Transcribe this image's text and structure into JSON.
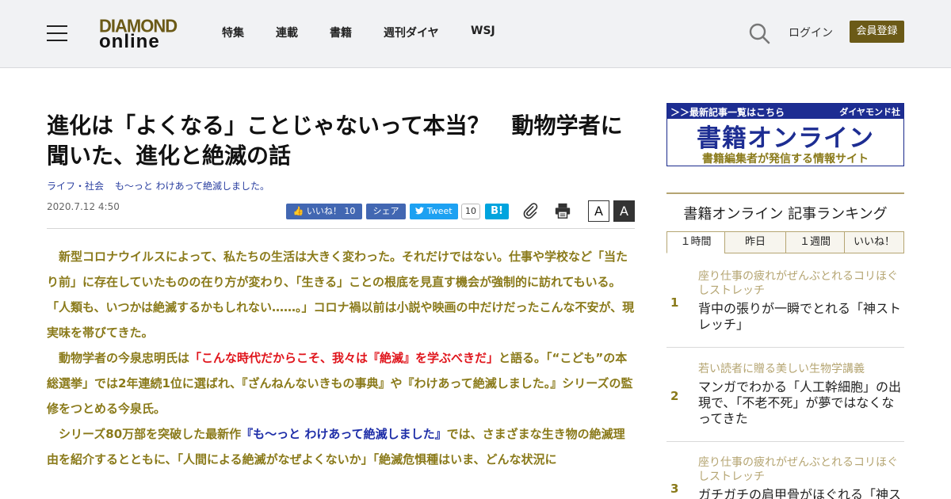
{
  "header": {
    "logo_line1": "DIAMOND",
    "logo_line2": "online",
    "nav": [
      "特集",
      "連載",
      "書籍",
      "週刊ダイヤ",
      "WSJ"
    ],
    "login": "ログイン",
    "register": "会員登録"
  },
  "article": {
    "title": "進化は「よくなる」ことじゃないって本当？　動物学者に聞いた、進化と絶滅の話",
    "categories": [
      "ライフ・社会",
      "も〜っと わけあって絶滅しました。"
    ],
    "date": "2020.7.12 4:50",
    "share": {
      "like": "いいね！",
      "like_count": "10",
      "fb_share": "シェア",
      "tweet": "Tweet",
      "tweet_count": "10",
      "hatena": "B!"
    },
    "font_small": "A",
    "font_large": "A",
    "paragraphs": {
      "p1": "　新型コロナウイルスによって、私たちの生活は大きく変わった。それだけではない。仕事や学校など「当たり前」に存在していたものの在り方が変わり、「生きる」ことの根底を見直す機会が強制的に訪れてもいる。",
      "p2": "「人類も、いつかは絶滅するかもしれない……。」コロナ禍以前は小説や映画の中だけだったこんな不安が、現実味を帯びてきた。",
      "p3a": "　動物学者の今泉忠明氏は",
      "p3b": "「こんな時代だからこそ、我々は『絶滅』を学ぶべきだ」",
      "p3c": "と語る。「“こども”の本総選挙」では2年連続1位に選ばれ、『ざんねんないきもの事典』や『わけあって絶滅しました。』シリーズの監修をつとめる今泉氏。",
      "p4a": "　シリーズ80万部を突破した最新作",
      "p4b": "『も〜っと わけあって絶滅しました』",
      "p4c": "では、さまざまな生き物の絶滅理由を紹介するとともに、「人間による絶滅がなぜよくないか」「絶滅危惧種はいま、どんな状況に"
    }
  },
  "sidebar": {
    "banner": {
      "top_left": "＞＞最新記事一覧はこちら",
      "top_right": "ダイヤモンド社",
      "main": "書籍オンライン",
      "sub": "書籍編集者が発信する情報サイト"
    },
    "ranking_title": "書籍オンライン 記事ランキング",
    "tabs": [
      "１時間",
      "昨日",
      "１週間",
      "いいね！"
    ],
    "items": [
      {
        "rank": "1",
        "sub": "座り仕事の疲れがぜんぶとれるコリほぐしストレッチ",
        "head": "背中の張りが一瞬でとれる「神ストレッチ」"
      },
      {
        "rank": "2",
        "sub": "若い読者に贈る美しい生物学講義",
        "head": "マンガでわかる「人工幹細胞」の出現で、「不老不死」が夢ではなくなってきた"
      },
      {
        "rank": "3",
        "sub": "座り仕事の疲れがぜんぶとれるコリほぐしストレッチ",
        "head": "ガチガチの肩甲骨がほぐれる「神ス"
      }
    ]
  }
}
